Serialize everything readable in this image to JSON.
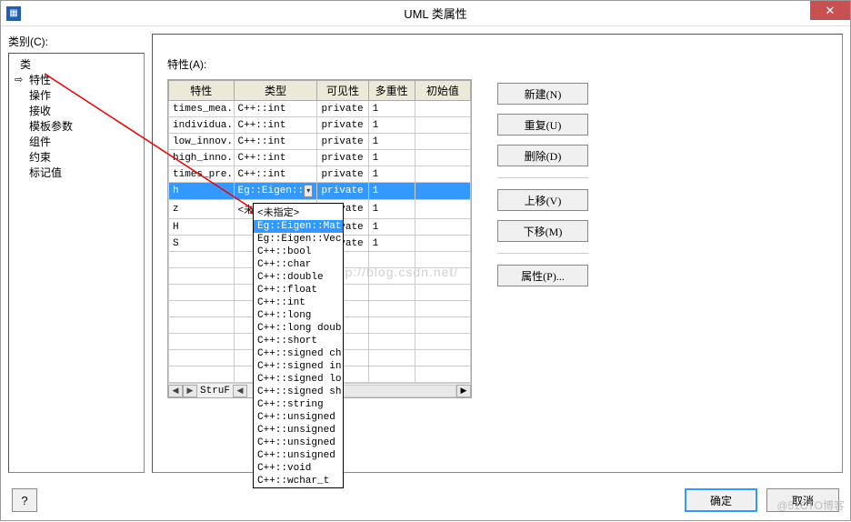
{
  "title": "UML 类属性",
  "left": {
    "label": "类别(C):",
    "items": [
      "类",
      "特性",
      "操作",
      "接收",
      "模板参数",
      "组件",
      "约束",
      "标记值"
    ],
    "selected_index": 1
  },
  "right": {
    "label": "特性(A):",
    "headers": [
      "特性",
      "类型",
      "可见性",
      "多重性",
      "初始值"
    ],
    "rows": [
      {
        "name": "times_mea...",
        "type": "C++::int",
        "vis": "private",
        "mult": "1",
        "init": ""
      },
      {
        "name": "individua...",
        "type": "C++::int",
        "vis": "private",
        "mult": "1",
        "init": ""
      },
      {
        "name": "low_innov...",
        "type": "C++::int",
        "vis": "private",
        "mult": "1",
        "init": ""
      },
      {
        "name": "high_inno...",
        "type": "C++::int",
        "vis": "private",
        "mult": "1",
        "init": ""
      },
      {
        "name": "times_pre...",
        "type": "C++::int",
        "vis": "private",
        "mult": "1",
        "init": ""
      },
      {
        "name": "h",
        "type": "Eg::Eigen::",
        "vis": "private",
        "mult": "1",
        "init": "",
        "selected": true,
        "combo": true
      },
      {
        "name": "z",
        "type": "<未指定>",
        "vis": "private",
        "mult": "1",
        "init": ""
      },
      {
        "name": "H",
        "type": "",
        "vis": "private",
        "mult": "1",
        "init": ""
      },
      {
        "name": "S",
        "type": "",
        "vis": "private",
        "mult": "1",
        "init": ""
      }
    ],
    "scroll_label": "StruF"
  },
  "dropdown": {
    "items": [
      "<未指定>",
      "Eg::Eigen::Mat",
      "Eg::Eigen::Vec",
      "C++::bool",
      "C++::char",
      "C++::double",
      "C++::float",
      "C++::int",
      "C++::long",
      "C++::long doub",
      "C++::short",
      "C++::signed ch",
      "C++::signed in",
      "C++::signed lo",
      "C++::signed sh",
      "C++::string",
      "C++::unsigned",
      "C++::unsigned",
      "C++::unsigned",
      "C++::unsigned",
      "C++::void",
      "C++::wchar_t"
    ],
    "highlighted_index": 1
  },
  "buttons": {
    "new": "新建(N)",
    "dup": "重复(U)",
    "del": "删除(D)",
    "up": "上移(V)",
    "down": "下移(M)",
    "prop": "属性(P)..."
  },
  "footer": {
    "help": "?",
    "ok": "确定",
    "cancel": "取消"
  },
  "watermark": "http://blog.csdn.net/",
  "watermark2": "@51CTO博客"
}
